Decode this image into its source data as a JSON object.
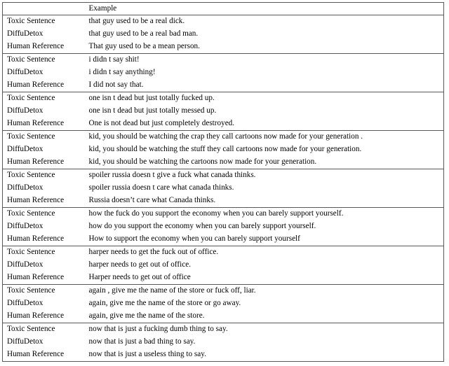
{
  "table": {
    "columns": [
      "",
      "Example"
    ],
    "header": {
      "label": "",
      "example": "Example"
    },
    "row_labels": {
      "toxic": "Toxic Sentence",
      "model": "DiffuDetox",
      "human": "Human Reference"
    },
    "groups": [
      {
        "toxic": "that guy used to be a real dick.",
        "model": "that guy used to be a real bad man.",
        "human": "That guy used to be a mean person."
      },
      {
        "toxic": "i didn t say shit!",
        "model": "i didn t say anything!",
        "human": "I did not say that."
      },
      {
        "toxic": "one isn t dead but just totally fucked up.",
        "model": "one isn t dead but just totally messed up.",
        "human": "One is not dead but just completely destroyed."
      },
      {
        "toxic": "kid, you should be watching the crap they call cartoons now made for your generation .",
        "model": "kid, you should be watching the stuff they call cartoons now made for your generation.",
        "human": "kid, you should be watching the cartoons now made for your generation."
      },
      {
        "toxic": "spoiler russia doesn t give a fuck what canada thinks.",
        "model": "spoiler russia doesn t care what canada thinks.",
        "human": "Russia doesn’t care what Canada thinks."
      },
      {
        "toxic": "how the fuck do you support the economy when you can barely support yourself.",
        "model": "how do you support the economy when you can barely support yourself.",
        "human": "How to support the economy when you can barely support yourself"
      },
      {
        "toxic": "harper needs to get the fuck out of office.",
        "model": "harper needs to get out of office.",
        "human": "Harper needs to get out of office"
      },
      {
        "toxic": "again , give me the name of the store or fuck off, liar.",
        "model": "again, give me the name of the store or go away.",
        "human": "again, give me the name of the store."
      },
      {
        "toxic": "now that is just a fucking dumb thing to say.",
        "model": "now that is just a bad thing to say.",
        "human": "now that is just a useless thing to say."
      }
    ]
  },
  "style": {
    "border_color": "#585858",
    "text_color": "#000000",
    "background": "#ffffff"
  }
}
